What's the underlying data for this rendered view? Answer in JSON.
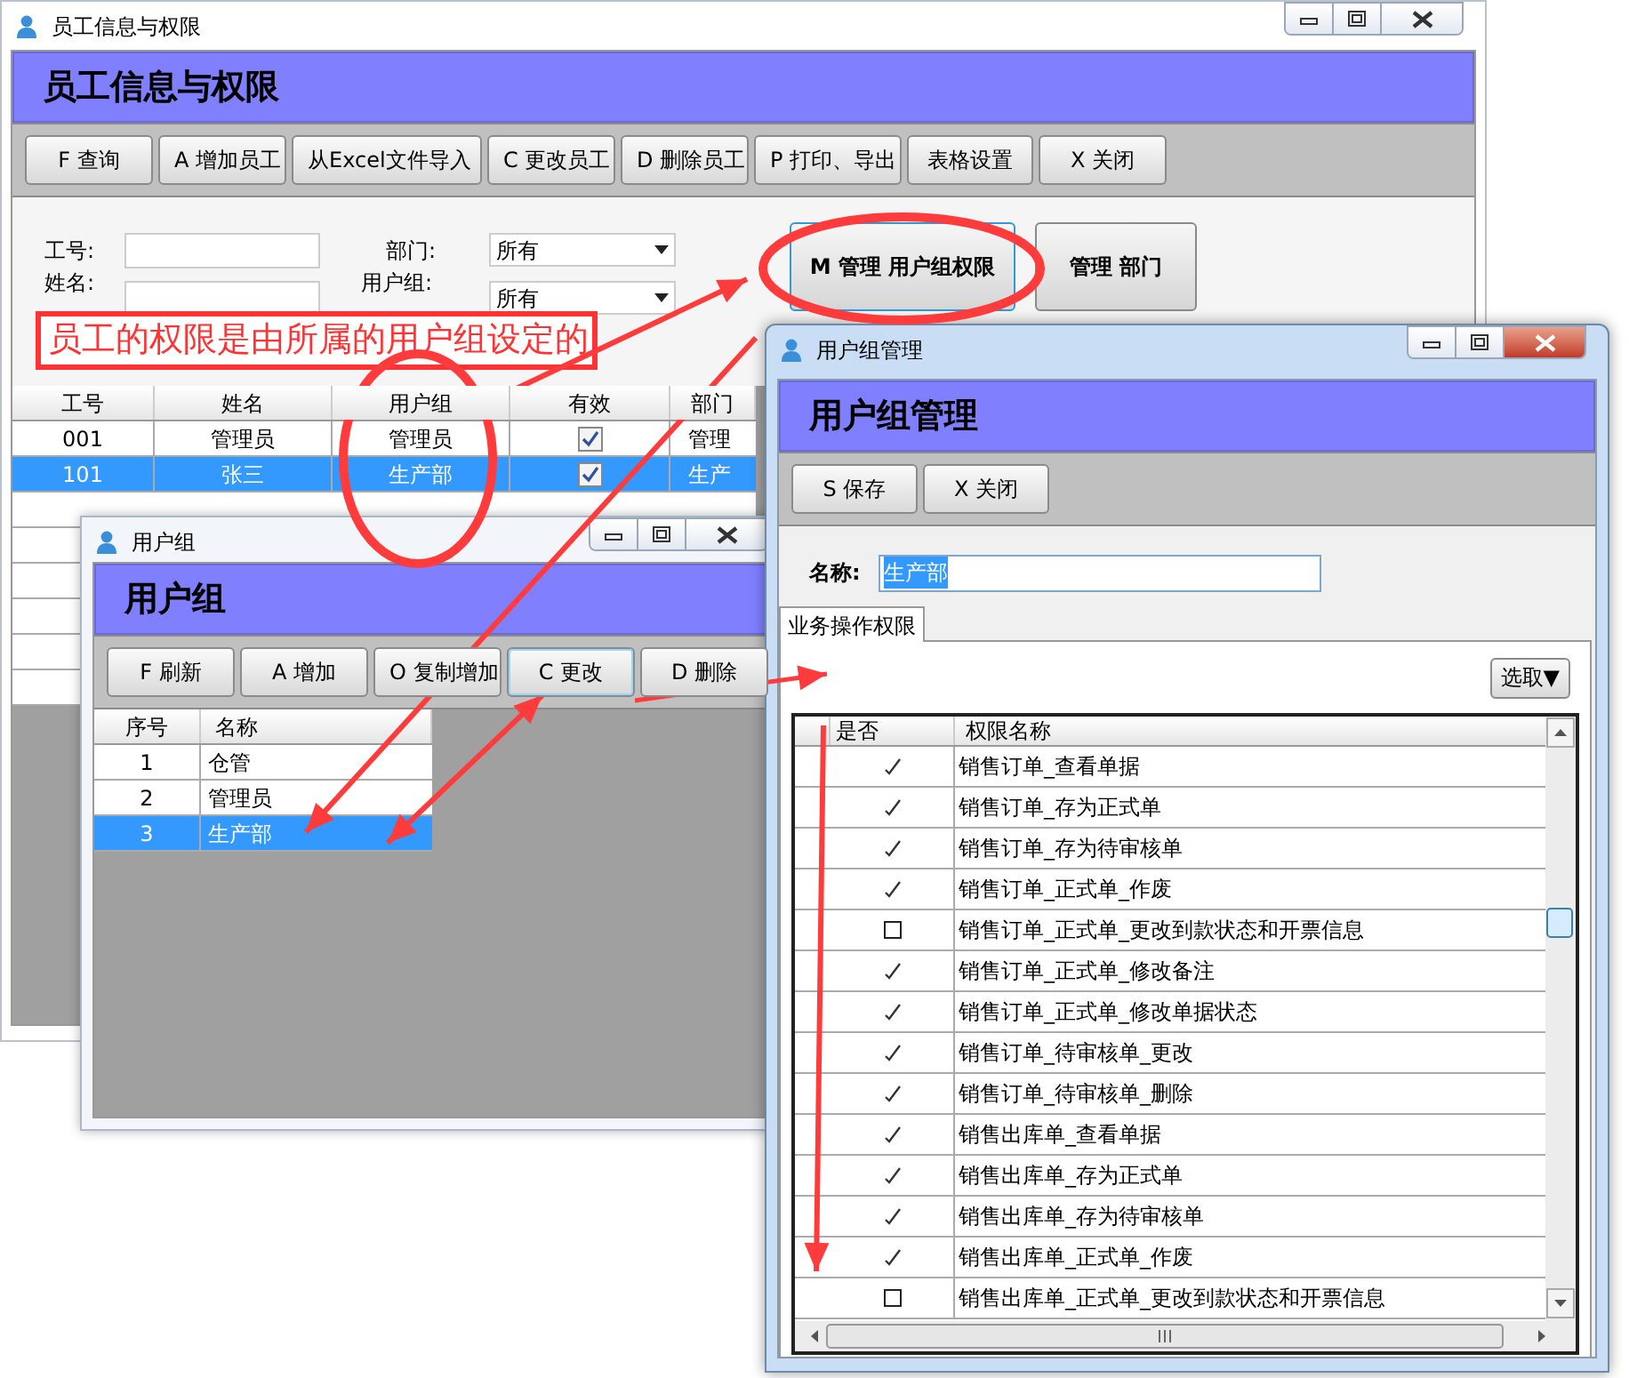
{
  "main_window": {
    "title": "员工信息与权限",
    "header": "员工信息与权限",
    "toolbar": [
      "F 查询",
      "A 增加员工",
      "从Excel文件导入",
      "C 更改员工",
      "D 删除员工",
      "P 打印、导出",
      "表格设置",
      "X 关闭"
    ],
    "filters": [
      {
        "label": "工号:",
        "kind": "text"
      },
      {
        "label": "部门:",
        "kind": "select",
        "value": "所有"
      },
      {
        "label": "姓名:",
        "kind": "text"
      },
      {
        "label": "用户组:",
        "kind": "select",
        "value": "所有"
      }
    ],
    "action_buttons": [
      {
        "label": "M 管理 用户组权限",
        "focused": true
      },
      {
        "label": "管理 部门",
        "focused": false
      }
    ],
    "table": {
      "columns": [
        "工号",
        "姓名",
        "用户组",
        "有效",
        "部门"
      ],
      "rows": [
        {
          "cells": [
            "001",
            "管理员",
            "管理员"
          ],
          "valid": true,
          "dept": "管理",
          "selected": false
        },
        {
          "cells": [
            "101",
            "张三",
            "生产部"
          ],
          "valid": true,
          "dept": "生产",
          "selected": true
        }
      ]
    }
  },
  "user_group_window": {
    "title": "用户组",
    "header": "用户组",
    "toolbar": [
      {
        "label": "F 刷新",
        "focused": false
      },
      {
        "label": "A 增加",
        "focused": false
      },
      {
        "label": "O 复制增加",
        "focused": false
      },
      {
        "label": "C 更改",
        "focused": true
      },
      {
        "label": "D 删除",
        "focused": false
      }
    ],
    "table": {
      "columns": [
        "序号",
        "名称"
      ],
      "rows": [
        {
          "no": "1",
          "name": "仓管",
          "selected": false
        },
        {
          "no": "2",
          "name": "管理员",
          "selected": false
        },
        {
          "no": "3",
          "name": "生产部",
          "selected": true
        }
      ]
    }
  },
  "group_manage_window": {
    "title": "用户组管理",
    "header": "用户组管理",
    "toolbar": [
      "S 保存",
      "X 关闭"
    ],
    "name_label": "名称:",
    "name_value": "生产部",
    "tabs": [
      {
        "label": "业务操作权限",
        "selected": true
      }
    ],
    "pick_button": "选取▼",
    "table": {
      "columns": [
        "是否",
        "权限名称"
      ],
      "rows": [
        {
          "allowed": true,
          "name": "销售订单_查看单据"
        },
        {
          "allowed": true,
          "name": "销售订单_存为正式单"
        },
        {
          "allowed": true,
          "name": "销售订单_存为待审核单"
        },
        {
          "allowed": true,
          "name": "销售订单_正式单_作废"
        },
        {
          "allowed": false,
          "name": "销售订单_正式单_更改到款状态和开票信息"
        },
        {
          "allowed": true,
          "name": "销售订单_正式单_修改备注"
        },
        {
          "allowed": true,
          "name": "销售订单_正式单_修改单据状态"
        },
        {
          "allowed": true,
          "name": "销售订单_待审核单_更改"
        },
        {
          "allowed": true,
          "name": "销售订单_待审核单_删除"
        },
        {
          "allowed": true,
          "name": "销售出库单_查看单据"
        },
        {
          "allowed": true,
          "name": "销售出库单_存为正式单"
        },
        {
          "allowed": true,
          "name": "销售出库单_存为待审核单"
        },
        {
          "allowed": true,
          "name": "销售出库单_正式单_作废"
        },
        {
          "allowed": false,
          "name": "销售出库单_正式单_更改到款状态和开票信息"
        }
      ]
    }
  },
  "annotation": {
    "note": "员工的权限是由所属的用户组设定的"
  }
}
